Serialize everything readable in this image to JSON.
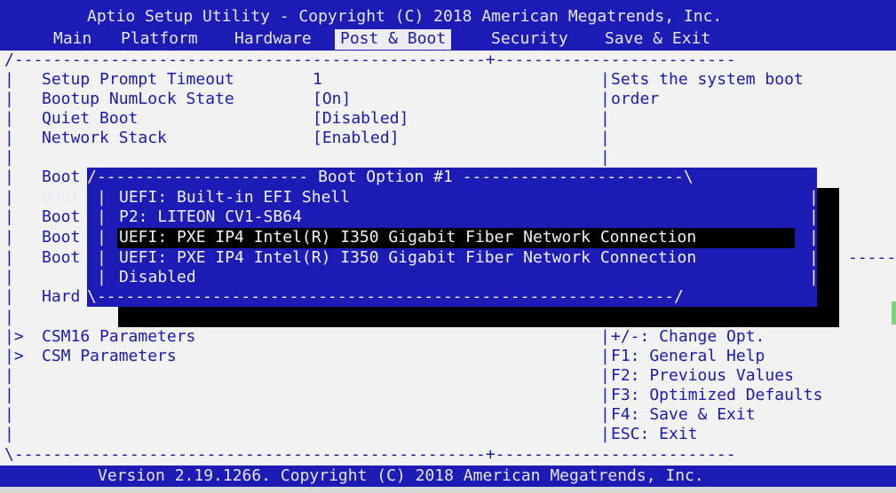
{
  "header": {
    "title": "Aptio Setup Utility - Copyright (C) 2018 American Megatrends, Inc.",
    "tabs": [
      {
        "label": "Main"
      },
      {
        "label": "Platform"
      },
      {
        "label": "Hardware"
      },
      {
        "label": "Post & Boot"
      },
      {
        "label": "Security"
      },
      {
        "label": "Save & Exit"
      }
    ]
  },
  "frame": {
    "top_left": "/-------------------------------------------------+-------------------------",
    "bottom": "\\-------------------------------------------------+-------------------------",
    "bar": "|",
    "gt": "|>",
    "right_dashes": "-----"
  },
  "settings": [
    {
      "label": "Setup Prompt Timeout",
      "value": "1"
    },
    {
      "label": "Bootup NumLock State",
      "value": "[On]"
    },
    {
      "label": "Quiet Boot",
      "value": "[Disabled]"
    },
    {
      "label": "Network Stack",
      "value": "[Enabled]"
    }
  ],
  "boot_rows": [
    "Boot",
    "Boot",
    "Boot",
    "Boot",
    "Boot"
  ],
  "hard_label": "Hard",
  "submenus": [
    "CSM16 Parameters",
    "CSM Parameters"
  ],
  "help": {
    "line1": "Sets the system boot",
    "line2": "order"
  },
  "keys": [
    "+/-: Change Opt.",
    "F1: General Help",
    "F2: Previous Values",
    "F3: Optimized Defaults",
    "F4: Save & Exit",
    "ESC: Exit"
  ],
  "popup": {
    "top": "/---------------------- Boot Option #1 -----------------------\\",
    "bottom": "\\------------------------------------------------------------/",
    "options": [
      "UEFI: Built-in EFI Shell",
      "P2: LITEON CV1-SB64",
      "UEFI: PXE IP4 Intel(R) I350 Gigabit Fiber Network Connection",
      "UEFI: PXE IP4 Intel(R) I350 Gigabit Fiber Network Connection",
      "Disabled"
    ],
    "selected_index": 2
  },
  "footer": {
    "version": "Version 2.19.1266. Copyright (C) 2018 American Megatrends, Inc."
  },
  "colors": {
    "bios_blue": "#1d1bb5",
    "text_blue": "#1a1ab0",
    "background": "#f2f2f2",
    "highlight": "#000000"
  }
}
